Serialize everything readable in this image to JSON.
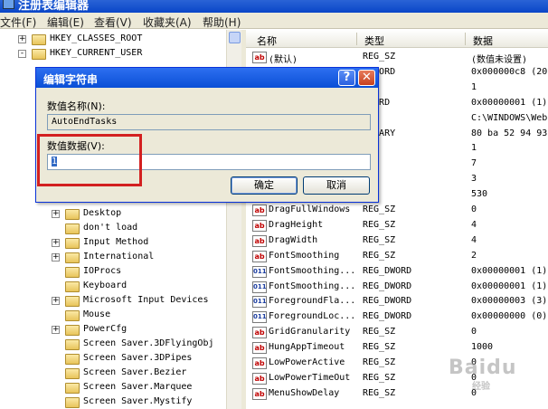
{
  "window": {
    "title": "注册表编辑器",
    "menu": [
      "文件(F)",
      "编辑(E)",
      "查看(V)",
      "收藏夹(A)",
      "帮助(H)"
    ]
  },
  "tree": [
    {
      "label": "HKEY_CLASSES_ROOT",
      "expander": "+"
    },
    {
      "label": "HKEY_CURRENT_USER",
      "expander": "-"
    },
    {
      "label": "Desktop",
      "expander": "+"
    },
    {
      "label": "don't load",
      "expander": ""
    },
    {
      "label": "Input Method",
      "expander": "+"
    },
    {
      "label": "International",
      "expander": "+"
    },
    {
      "label": "IOProcs",
      "expander": ""
    },
    {
      "label": "Keyboard",
      "expander": ""
    },
    {
      "label": "Microsoft Input Devices",
      "expander": "+"
    },
    {
      "label": "Mouse",
      "expander": ""
    },
    {
      "label": "PowerCfg",
      "expander": "+"
    },
    {
      "label": "Screen Saver.3DFlyingObj",
      "expander": ""
    },
    {
      "label": "Screen Saver.3DPipes",
      "expander": ""
    },
    {
      "label": "Screen Saver.Bezier",
      "expander": ""
    },
    {
      "label": "Screen Saver.Marquee",
      "expander": ""
    },
    {
      "label": "Screen Saver.Mystify",
      "expander": ""
    }
  ],
  "list": {
    "columns": [
      "名称",
      "类型",
      "数据"
    ],
    "rows": [
      {
        "icon": "ab",
        "name": "(默认)",
        "type": "REG_SZ",
        "data": "(数值未设置)"
      },
      {
        "icon": "ab",
        "name": "",
        "type": "_DWORD",
        "data": "0x000000c8 (20"
      },
      {
        "icon": "ab",
        "name": "",
        "type": "SZ",
        "data": "1"
      },
      {
        "icon": "ab",
        "name": "",
        "type": "DWORD",
        "data": "0x00000001 (1)"
      },
      {
        "icon": "ab",
        "name": "",
        "type": "SZ",
        "data": "C:\\WINDOWS\\Web"
      },
      {
        "icon": "ab",
        "name": "",
        "type": "BINARY",
        "data": "80 ba 52 94 93"
      },
      {
        "icon": "ab",
        "name": "",
        "type": "SZ",
        "data": "1"
      },
      {
        "icon": "ab",
        "name": "",
        "type": "SZ",
        "data": "7"
      },
      {
        "icon": "ab",
        "name": "",
        "type": "SZ",
        "data": "3"
      },
      {
        "icon": "ab",
        "name": "",
        "type": "SZ",
        "data": "530"
      },
      {
        "icon": "ab",
        "name": "DragFullWindows",
        "type": "REG_SZ",
        "data": "0"
      },
      {
        "icon": "ab",
        "name": "DragHeight",
        "type": "REG_SZ",
        "data": "4"
      },
      {
        "icon": "ab",
        "name": "DragWidth",
        "type": "REG_SZ",
        "data": "4"
      },
      {
        "icon": "ab",
        "name": "FontSmoothing",
        "type": "REG_SZ",
        "data": "2"
      },
      {
        "icon": "dw",
        "name": "FontSmoothing...",
        "type": "REG_DWORD",
        "data": "0x00000001 (1)"
      },
      {
        "icon": "dw",
        "name": "FontSmoothing...",
        "type": "REG_DWORD",
        "data": "0x00000001 (1)"
      },
      {
        "icon": "dw",
        "name": "ForegroundFla...",
        "type": "REG_DWORD",
        "data": "0x00000003 (3)"
      },
      {
        "icon": "dw",
        "name": "ForegroundLoc...",
        "type": "REG_DWORD",
        "data": "0x00000000 (0)"
      },
      {
        "icon": "ab",
        "name": "GridGranularity",
        "type": "REG_SZ",
        "data": "0"
      },
      {
        "icon": "ab",
        "name": "HungAppTimeout",
        "type": "REG_SZ",
        "data": "1000"
      },
      {
        "icon": "ab",
        "name": "LowPowerActive",
        "type": "REG_SZ",
        "data": "0"
      },
      {
        "icon": "ab",
        "name": "LowPowerTimeOut",
        "type": "REG_SZ",
        "data": "0"
      },
      {
        "icon": "ab",
        "name": "MenuShowDelay",
        "type": "REG_SZ",
        "data": "0"
      }
    ]
  },
  "dialog": {
    "title": "编辑字符串",
    "help_glyph": "?",
    "close_glyph": "✕",
    "name_label": "数值名称(N):",
    "name_value": "AutoEndTasks",
    "data_label": "数值数据(V):",
    "data_value": "1",
    "ok_label": "确定",
    "cancel_label": "取消"
  },
  "watermark": {
    "text": "Baidu",
    "sub": "经验"
  },
  "colors": {
    "accent": "#0a4fd6",
    "highlight_box": "#d32020"
  }
}
